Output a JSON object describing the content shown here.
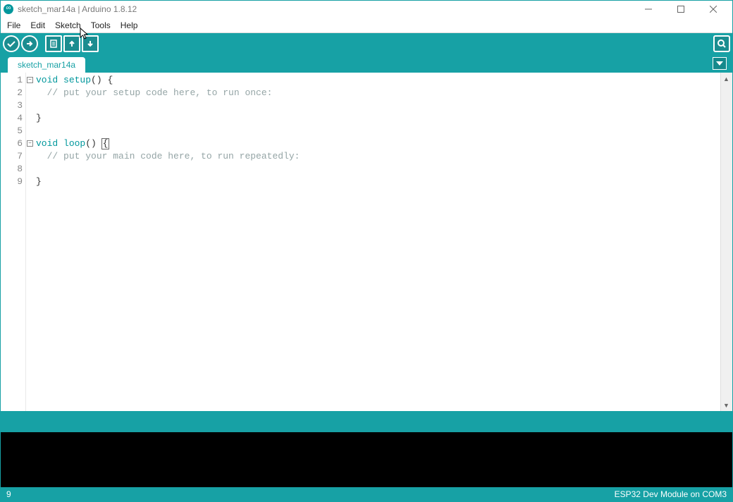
{
  "window": {
    "title": "sketch_mar14a | Arduino 1.8.12"
  },
  "menu": {
    "file": "File",
    "edit": "Edit",
    "sketch": "Sketch",
    "tools": "Tools",
    "help": "Help"
  },
  "tabs": [
    {
      "label": "sketch_mar14a"
    }
  ],
  "code": {
    "lines": [
      {
        "n": "1",
        "fold": true,
        "segs": [
          {
            "t": "void",
            "c": "kw"
          },
          {
            "t": " ",
            "c": ""
          },
          {
            "t": "setup",
            "c": "kw"
          },
          {
            "t": "() {",
            "c": "punct"
          }
        ]
      },
      {
        "n": "2",
        "segs": [
          {
            "t": "  ",
            "c": ""
          },
          {
            "t": "// put your setup code here, to run once:",
            "c": "com"
          }
        ]
      },
      {
        "n": "3",
        "segs": []
      },
      {
        "n": "4",
        "segs": [
          {
            "t": "}",
            "c": "punct"
          }
        ]
      },
      {
        "n": "5",
        "segs": []
      },
      {
        "n": "6",
        "fold": true,
        "segs": [
          {
            "t": "void",
            "c": "kw"
          },
          {
            "t": " ",
            "c": ""
          },
          {
            "t": "loop",
            "c": "kw"
          },
          {
            "t": "() ",
            "c": "punct"
          },
          {
            "t": "{",
            "c": "punct",
            "hl": true
          }
        ]
      },
      {
        "n": "7",
        "segs": [
          {
            "t": "  ",
            "c": ""
          },
          {
            "t": "// put your main code here, to run repeatedly:",
            "c": "com"
          }
        ]
      },
      {
        "n": "8",
        "segs": []
      },
      {
        "n": "9",
        "segs": [
          {
            "t": "}",
            "c": "punct"
          }
        ]
      }
    ]
  },
  "footer": {
    "line_indicator": "9",
    "board_port": "ESP32 Dev Module on COM3"
  }
}
